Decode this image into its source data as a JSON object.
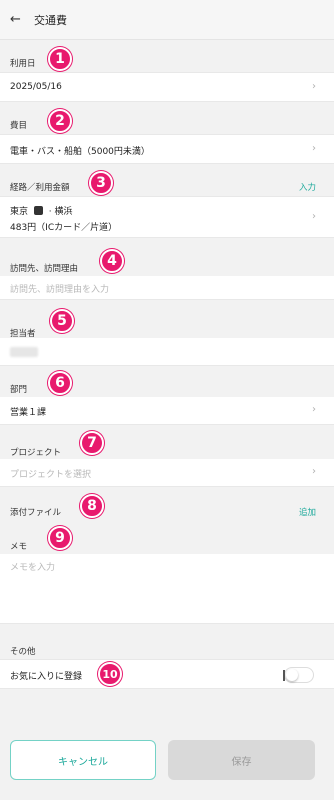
{
  "header": {
    "back_icon": "←",
    "title": "交通費"
  },
  "fields": {
    "date": {
      "label": "利用日",
      "value": "2025/05/16",
      "badge": "1"
    },
    "category": {
      "label": "費目",
      "value": "電車・バス・船舶（5000円未満）",
      "badge": "2"
    },
    "route": {
      "label": "経路／利用金額",
      "action": "入力",
      "from": "東京",
      "to": "横浜",
      "amount": "483円（ICカード／片道）",
      "badge": "3"
    },
    "visit": {
      "label": "訪問先、訪問理由",
      "placeholder": "訪問先、訪問理由を入力",
      "badge": "4"
    },
    "person": {
      "label": "担当者",
      "badge": "5"
    },
    "department": {
      "label": "部門",
      "value": "営業１課",
      "badge": "6"
    },
    "project": {
      "label": "プロジェクト",
      "placeholder": "プロジェクトを選択",
      "badge": "7"
    },
    "attachment": {
      "label": "添付ファイル",
      "action": "追加",
      "badge": "8"
    },
    "memo": {
      "label": "メモ",
      "placeholder": "メモを入力",
      "badge": "9"
    },
    "other": {
      "label": "その他",
      "favorite_label": "お気に入りに登録",
      "favorite_on": false,
      "badge": "10"
    }
  },
  "buttons": {
    "cancel": "キャンセル",
    "save": "保存"
  },
  "colors": {
    "accent": "#1aa89a",
    "badge": "#e8196d"
  }
}
